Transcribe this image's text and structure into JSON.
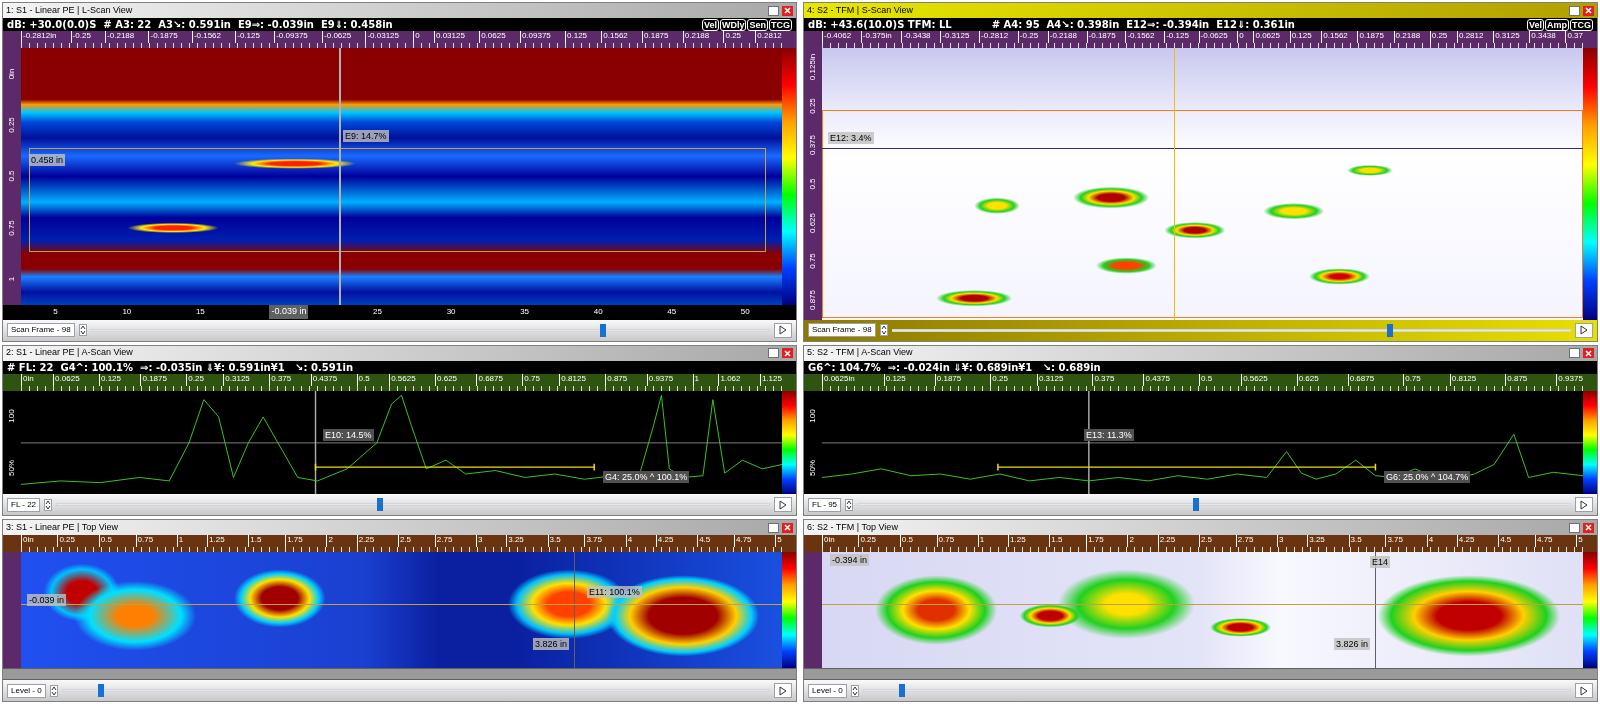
{
  "panels": [
    {
      "title": "1: S1 - Linear PE | L-Scan View",
      "selected": false,
      "kind": "lscan",
      "info": [
        "dB: +30.0(0.0)S  # A3: 22  A3↘: 0.591in  E9⇒: -0.039in  E9⇓: 0.458in"
      ],
      "buttons": [
        "Vel",
        "WDly",
        "Sen",
        "TCG"
      ],
      "ruler": [
        "-0.2812in",
        "-0.25",
        "-0.2188",
        "-0.1875",
        "-0.1562",
        "-0.125",
        "-0.09375",
        "-0.0625",
        "-0.03125",
        "0",
        "0.03125",
        "0.0625",
        "0.09375",
        "0.125",
        "0.1562",
        "0.1875",
        "0.2188",
        "0.25",
        "0.2812"
      ],
      "left_axis": [
        "0in",
        "0.25",
        "0.5",
        "0.75",
        "1"
      ],
      "overlays": [
        "E9: 14.7%",
        "0.458 in"
      ],
      "bottom_axis": [
        {
          "label": "5",
          "kind": "tick"
        },
        {
          "label": "10",
          "kind": "tick"
        },
        {
          "label": "15",
          "kind": "tick"
        },
        {
          "label": "-0.039 in",
          "kind": "marker"
        },
        {
          "label": "25",
          "kind": "tick"
        },
        {
          "label": "30",
          "kind": "tick"
        },
        {
          "label": "35",
          "kind": "tick"
        },
        {
          "label": "40",
          "kind": "tick"
        },
        {
          "label": "45",
          "kind": "tick"
        },
        {
          "label": "50",
          "kind": "tick"
        }
      ],
      "slider": {
        "label": "Scan Frame - 98",
        "level": 0.75
      }
    },
    {
      "title": "2: S1 - Linear PE | A-Scan View",
      "selected": false,
      "kind": "ascan",
      "info": [
        "# FL: 22  G4^: 100.1%  ⇒: -0.035in ⇓¥: 0.591in¥1   ↘: 0.591in"
      ],
      "ruler": [
        "0in",
        "0.0625",
        "0.125",
        "0.1875",
        "0.25",
        "0.3125",
        "0.375",
        "0.4375",
        "0.5",
        "0.5625",
        "0.625",
        "0.6875",
        "0.75",
        "0.8125",
        "0.875",
        "0.9375",
        "1",
        "1.062",
        "1.125"
      ],
      "left_axis": [
        "100",
        "50%"
      ],
      "overlays": [
        "E10: 14.5%",
        "G4: 25.0% ^ 100.1%"
      ],
      "slider": {
        "label": "FL - 22",
        "level": 0.45
      }
    },
    {
      "title": "3: S1 - Linear PE | Top View",
      "selected": false,
      "kind": "top",
      "ruler": [
        "0in",
        "0.25",
        "0.5",
        "0.75",
        "1",
        "1.25",
        "1.5",
        "1.75",
        "2",
        "2.25",
        "2.5",
        "2.75",
        "3",
        "3.25",
        "3.5",
        "3.75",
        "4",
        "4.25",
        "4.5",
        "4.75",
        "5"
      ],
      "overlays": [
        "E11: 100.1%",
        "-0.039 in",
        "3.826 in"
      ],
      "slider": {
        "label": "Level - 0",
        "level": 0.05
      }
    },
    {
      "title": "4: S2 - TFM | S-Scan View",
      "selected": true,
      "kind": "sscan",
      "info": [
        "dB: +43.6(10.0)S TFM: LL",
        "# A4: 95  A4↘: 0.398in  E12⇒: -0.394in  E12⇓: 0.361in"
      ],
      "buttons": [
        "Vel",
        "Amp",
        "TCG"
      ],
      "ruler": [
        "-0.4062",
        "-0.375in",
        "-0.3438",
        "-0.3125",
        "-0.2812",
        "-0.25",
        "-0.2188",
        "-0.1875",
        "-0.1562",
        "-0.125",
        "-0.0625",
        "0",
        "0.0625",
        "0.125",
        "0.1562",
        "0.1875",
        "0.2188",
        "0.25",
        "0.2812",
        "0.3125",
        "0.3438",
        "0.37"
      ],
      "left_axis": [
        "0.125in",
        "0.25",
        "0.375",
        "0.5",
        "0.625",
        "0.75",
        "0.875"
      ],
      "overlays": [
        "E12: 3.4%"
      ],
      "slider": {
        "label": "Scan Frame - 98",
        "level": 0.73
      }
    },
    {
      "title": "5: S2 - TFM | A-Scan View",
      "selected": false,
      "kind": "ascan",
      "info": [
        "G6^: 104.7%  ⇒: -0.024in ⇓¥: 0.689in¥1   ↘: 0.689in"
      ],
      "ruler": [
        "0.0625in",
        "0.125",
        "0.1875",
        "0.25",
        "0.3125",
        "0.375",
        "0.4375",
        "0.5",
        "0.5625",
        "0.625",
        "0.6875",
        "0.75",
        "0.8125",
        "0.875",
        "0.9375"
      ],
      "left_axis": [
        "100",
        "50%"
      ],
      "overlays": [
        "E13: 11.3%",
        "G6: 25.0% ^ 104.7%"
      ],
      "slider": {
        "label": "FL - 95",
        "level": 0.47
      }
    },
    {
      "title": "6: S2 - TFM | Top View",
      "selected": false,
      "kind": "toptfm",
      "ruler": [
        "0in",
        "0.25",
        "0.5",
        "0.75",
        "1",
        "1.25",
        "1.5",
        "1.75",
        "2",
        "2.25",
        "2.5",
        "2.75",
        "3",
        "3.25",
        "3.5",
        "3.75",
        "4",
        "4.25",
        "4.5",
        "4.75",
        "5"
      ],
      "overlays": [
        "-0.394 in",
        "E14",
        "3.826 in"
      ],
      "slider": {
        "label": "Level - 0",
        "level": 0.05
      }
    }
  ]
}
